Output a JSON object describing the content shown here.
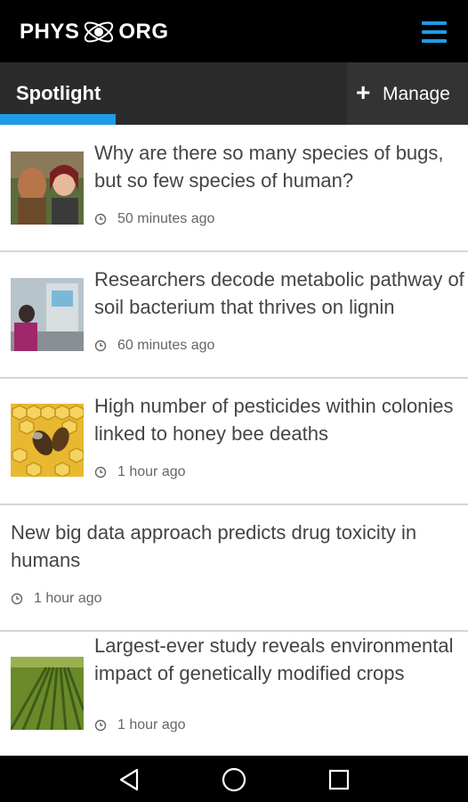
{
  "app": {
    "logo_left": "PHYS",
    "logo_right": "ORG",
    "accent_color": "#1e9be6"
  },
  "tabs": {
    "spotlight_label": "Spotlight",
    "manage_label": "Manage"
  },
  "articles": [
    {
      "title": "Why are there so many species of bugs, but so few species of human?",
      "time": "50 minutes ago",
      "thumb": "people-photo"
    },
    {
      "title": "Researchers decode metabolic pathway of soil bacterium that thrives on lignin",
      "time": "60 minutes ago",
      "thumb": "lab-photo"
    },
    {
      "title": "High number of pesticides within colonies linked to honey bee deaths",
      "time": "1 hour ago",
      "thumb": "bees-photo"
    },
    {
      "title": "New big data approach predicts drug toxicity in humans",
      "time": "1 hour ago",
      "thumb": null
    },
    {
      "title": "Largest-ever study reveals environmental impact of genetically modified crops",
      "time": "1 hour ago",
      "thumb": "crops-photo"
    }
  ],
  "navbar": {
    "icons": [
      "back-icon",
      "home-icon",
      "recents-icon"
    ]
  }
}
